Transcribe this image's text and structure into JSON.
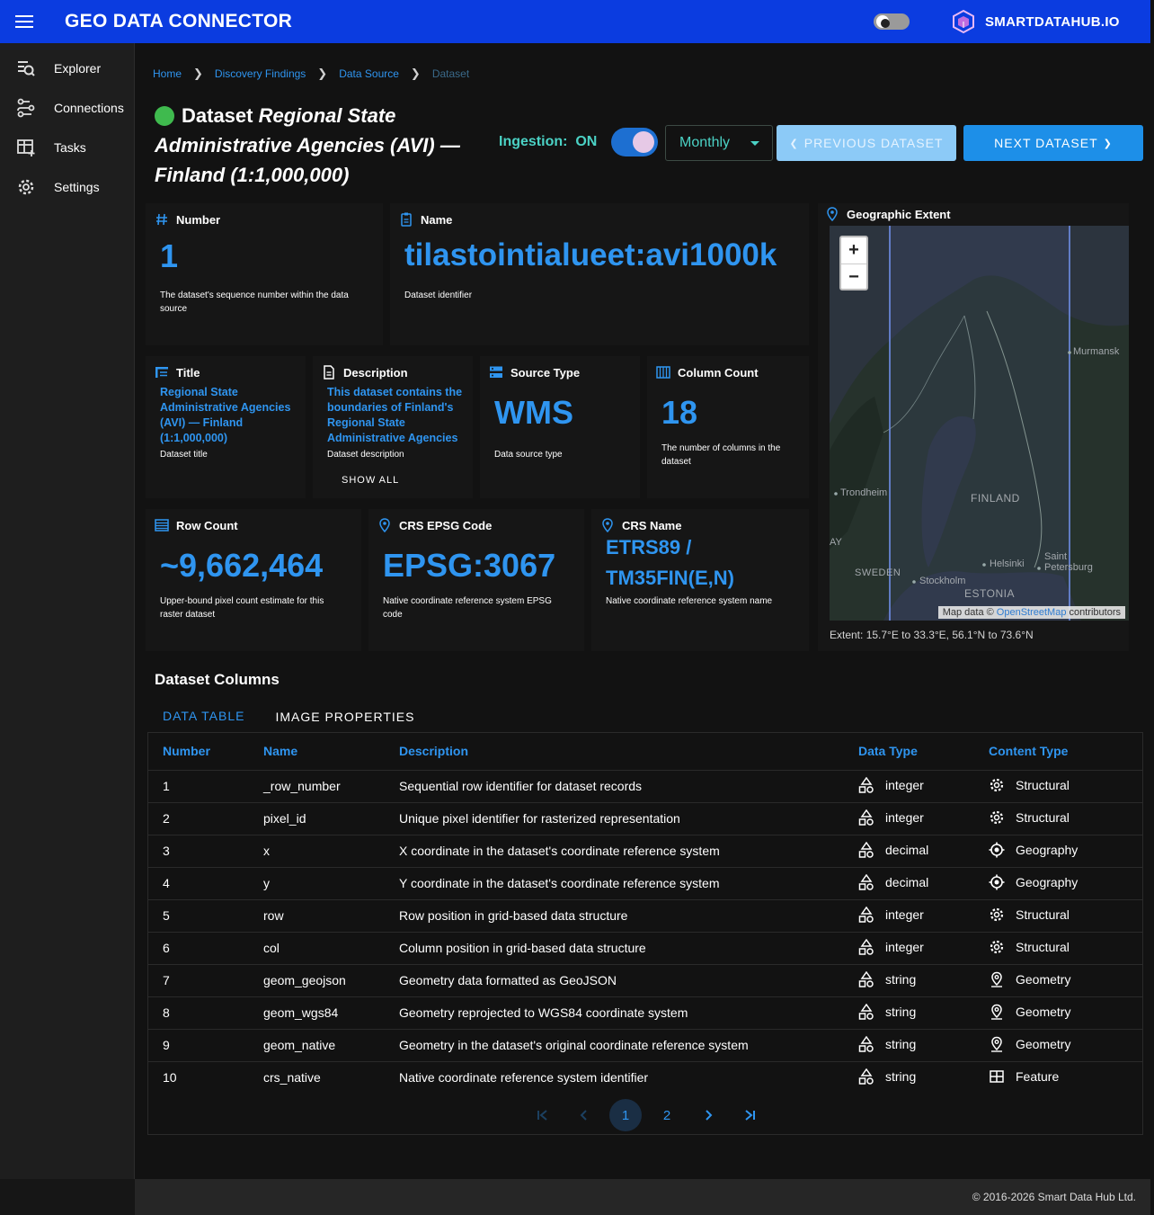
{
  "app": {
    "title": "GEO DATA CONNECTOR",
    "brand": "SMARTDATAHUB.IO"
  },
  "sidebar": {
    "items": [
      {
        "label": "Explorer",
        "icon": "explorer-icon"
      },
      {
        "label": "Connections",
        "icon": "connections-icon"
      },
      {
        "label": "Tasks",
        "icon": "tasks-icon"
      },
      {
        "label": "Settings",
        "icon": "gear-icon"
      }
    ]
  },
  "breadcrumb": [
    "Home",
    "Discovery Findings",
    "Data Source",
    "Dataset"
  ],
  "dataset": {
    "title_prefix": "Dataset ",
    "title_main": "Regional State Administrative Agencies (AVI) — Finland (1:1,000,000)",
    "status_color": "#3fba4e"
  },
  "controls": {
    "ingestion_label": "Ingestion:",
    "ingestion_state": "ON",
    "frequency": "Monthly",
    "prev_label": "PREVIOUS DATASET",
    "next_label": "NEXT DATASET"
  },
  "cards": {
    "number": {
      "label": "Number",
      "value": "1",
      "desc": "The dataset's sequence number within the data source"
    },
    "name": {
      "label": "Name",
      "value": "tilastointialueet:avi1000k",
      "desc": "Dataset identifier"
    },
    "title": {
      "label": "Title",
      "value": "Regional State Administrative Agencies (AVI) — Finland (1:1,000,000)",
      "desc": "Dataset title"
    },
    "description": {
      "label": "Description",
      "value": "This dataset contains the boundaries of Finland's Regional State Administrative Agencies",
      "desc": "Dataset description",
      "show_all": "SHOW ALL"
    },
    "source_type": {
      "label": "Source Type",
      "value": "WMS",
      "desc": "Data source type"
    },
    "column_count": {
      "label": "Column Count",
      "value": "18",
      "desc": "The number of columns in the dataset"
    },
    "row_count": {
      "label": "Row Count",
      "value": "~9,662,464",
      "desc": "Upper-bound pixel count estimate for this raster dataset"
    },
    "crs_epsg": {
      "label": "CRS EPSG Code",
      "value": "EPSG:3067",
      "desc": "Native coordinate reference system EPSG code"
    },
    "crs_name": {
      "label": "CRS Name",
      "value": "ETRS89 / TM35FIN(E,N)",
      "desc": "Native coordinate reference system name"
    }
  },
  "map": {
    "label": "Geographic Extent",
    "zoom_in": "+",
    "zoom_out": "−",
    "places": [
      "Murmansk",
      "Trondheim",
      "FINLAND",
      "AY",
      "SWEDEN",
      "Helsinki",
      "Saint Petersburg",
      "Stockholm",
      "ESTONIA"
    ],
    "attribution_prefix": "Map data ©",
    "attribution_link": "OpenStreetMap",
    "attribution_suffix": "contributors",
    "extent": "Extent: 15.7°E to 33.3°E, 56.1°N to 73.6°N"
  },
  "columns_section": {
    "title": "Dataset Columns",
    "tabs": [
      "DATA TABLE",
      "IMAGE PROPERTIES"
    ],
    "headers": [
      "Number",
      "Name",
      "Description",
      "Data Type",
      "Content Type"
    ],
    "rows": [
      {
        "number": "1",
        "name": "_row_number",
        "description": "Sequential row identifier for dataset records",
        "data_type": "integer",
        "content_type": "Structural",
        "content_icon": "gear-icon"
      },
      {
        "number": "2",
        "name": "pixel_id",
        "description": "Unique pixel identifier for rasterized representation",
        "data_type": "integer",
        "content_type": "Structural",
        "content_icon": "gear-icon"
      },
      {
        "number": "3",
        "name": "x",
        "description": "X coordinate in the dataset's coordinate reference system",
        "data_type": "decimal",
        "content_type": "Geography",
        "content_icon": "crosshair-icon"
      },
      {
        "number": "4",
        "name": "y",
        "description": "Y coordinate in the dataset's coordinate reference system",
        "data_type": "decimal",
        "content_type": "Geography",
        "content_icon": "crosshair-icon"
      },
      {
        "number": "5",
        "name": "row",
        "description": "Row position in grid-based data structure",
        "data_type": "integer",
        "content_type": "Structural",
        "content_icon": "gear-icon"
      },
      {
        "number": "6",
        "name": "col",
        "description": "Column position in grid-based data structure",
        "data_type": "integer",
        "content_type": "Structural",
        "content_icon": "gear-icon"
      },
      {
        "number": "7",
        "name": "geom_geojson",
        "description": "Geometry data formatted as GeoJSON",
        "data_type": "string",
        "content_type": "Geometry",
        "content_icon": "location-pin-icon"
      },
      {
        "number": "8",
        "name": "geom_wgs84",
        "description": "Geometry reprojected to WGS84 coordinate system",
        "data_type": "string",
        "content_type": "Geometry",
        "content_icon": "location-pin-icon"
      },
      {
        "number": "9",
        "name": "geom_native",
        "description": "Geometry in the dataset's original coordinate reference system",
        "data_type": "string",
        "content_type": "Geometry",
        "content_icon": "location-pin-icon"
      },
      {
        "number": "10",
        "name": "crs_native",
        "description": "Native coordinate reference system identifier",
        "data_type": "string",
        "content_type": "Feature",
        "content_icon": "grid-table-icon"
      }
    ]
  },
  "pagination": {
    "pages": [
      "1",
      "2"
    ],
    "current": "1"
  },
  "footer": {
    "text": "© 2016-2026 Smart Data Hub Ltd."
  }
}
